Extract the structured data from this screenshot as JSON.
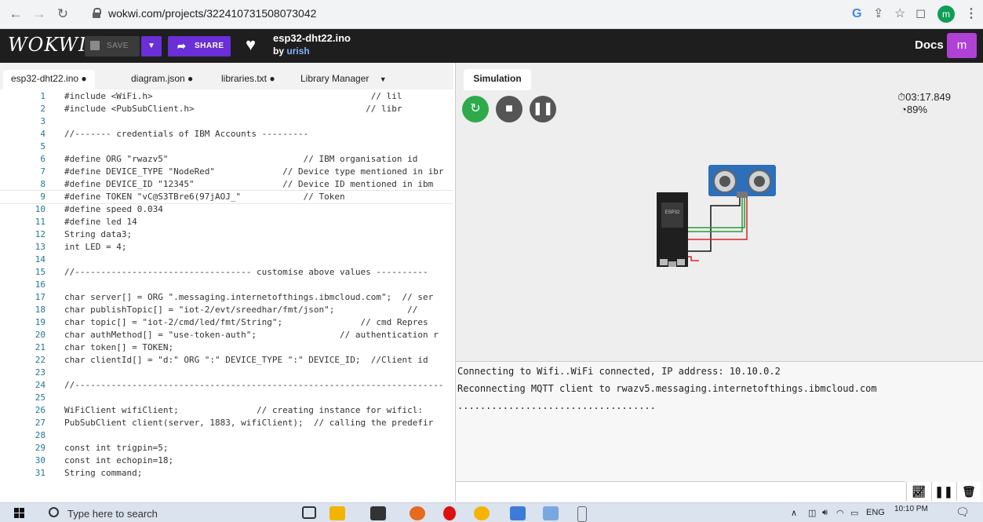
{
  "browser": {
    "url": "wokwi.com/projects/322410731508073042",
    "profile_initial": "m"
  },
  "header": {
    "logo": "WOKWI",
    "save_label": "SAVE",
    "share_label": "SHARE",
    "project_name": "esp32-dht22.ino",
    "by_label": "by",
    "author": "urish",
    "docs_label": "Docs",
    "user_initial": "m"
  },
  "editor": {
    "tabs": [
      {
        "label": "esp32-dht22.ino ●"
      },
      {
        "label": "diagram.json ●"
      },
      {
        "label": "libraries.txt ●"
      },
      {
        "label": "Library Manager"
      }
    ],
    "lines": [
      {
        "n": "1",
        "text": "#include <WiFi.h>                                          // lil"
      },
      {
        "n": "2",
        "text": "#include <PubSubClient.h>                                 // libr"
      },
      {
        "n": "3",
        "text": ""
      },
      {
        "n": "4",
        "text": "//------- credentials of IBM Accounts ---------"
      },
      {
        "n": "5",
        "text": ""
      },
      {
        "n": "6",
        "text": "#define ORG \"rwazv5\"                          // IBM organisation id"
      },
      {
        "n": "7",
        "text": "#define DEVICE_TYPE \"NodeRed\"             // Device type mentioned in ibr"
      },
      {
        "n": "8",
        "text": "#define DEVICE_ID \"12345\"                 // Device ID mentioned in ibm"
      },
      {
        "n": "9",
        "text": "#define TOKEN \"vC@S3TBre6(97jAOJ_\"            // Token"
      },
      {
        "n": "10",
        "text": "#define speed 0.034"
      },
      {
        "n": "11",
        "text": "#define led 14"
      },
      {
        "n": "12",
        "text": "String data3;"
      },
      {
        "n": "13",
        "text": "int LED = 4;"
      },
      {
        "n": "14",
        "text": ""
      },
      {
        "n": "15",
        "text": "//---------------------------------- customise above values ----------"
      },
      {
        "n": "16",
        "text": ""
      },
      {
        "n": "17",
        "text": "char server[] = ORG \".messaging.internetofthings.ibmcloud.com\";  // ser"
      },
      {
        "n": "18",
        "text": "char publishTopic[] = \"iot-2/evt/sreedhar/fmt/json\";              //"
      },
      {
        "n": "19",
        "text": "char topic[] = \"iot-2/cmd/led/fmt/String\";               // cmd Repres"
      },
      {
        "n": "20",
        "text": "char authMethod[] = \"use-token-auth\";                // authentication r"
      },
      {
        "n": "21",
        "text": "char token[] = TOKEN;"
      },
      {
        "n": "22",
        "text": "char clientId[] = \"d:\" ORG \":\" DEVICE_TYPE \":\" DEVICE_ID;  //Client id"
      },
      {
        "n": "23",
        "text": ""
      },
      {
        "n": "24",
        "text": "//-----------------------------------------------------------------------"
      },
      {
        "n": "25",
        "text": ""
      },
      {
        "n": "26",
        "text": "WiFiClient wifiClient;               // creating instance for wificl:"
      },
      {
        "n": "27",
        "text": "PubSubClient client(server, 1883, wifiClient);  // calling the predefir"
      },
      {
        "n": "28",
        "text": ""
      },
      {
        "n": "29",
        "text": "const int trigpin=5;"
      },
      {
        "n": "30",
        "text": "const int echopin=18;"
      },
      {
        "n": "31",
        "text": "String command;"
      }
    ]
  },
  "simulation": {
    "tab_label": "Simulation",
    "timer": "03:17.849",
    "speed": "89%",
    "esp_label": "ESP32"
  },
  "serial": {
    "lines": [
      "Connecting to Wifi..WiFi connected, IP address: 10.10.0.2",
      "Reconnecting MQTT client to rwazv5.messaging.internetofthings.ibmcloud.com",
      "..................................."
    ]
  },
  "taskbar": {
    "search_placeholder": "Type here to search",
    "language": "ENG",
    "time": "10:10 PM"
  },
  "colors": {
    "accent": "#6a2fd6",
    "header_bg": "#1e1e1e",
    "play_green": "#2eaa4a",
    "avatar": "#b041d6"
  }
}
